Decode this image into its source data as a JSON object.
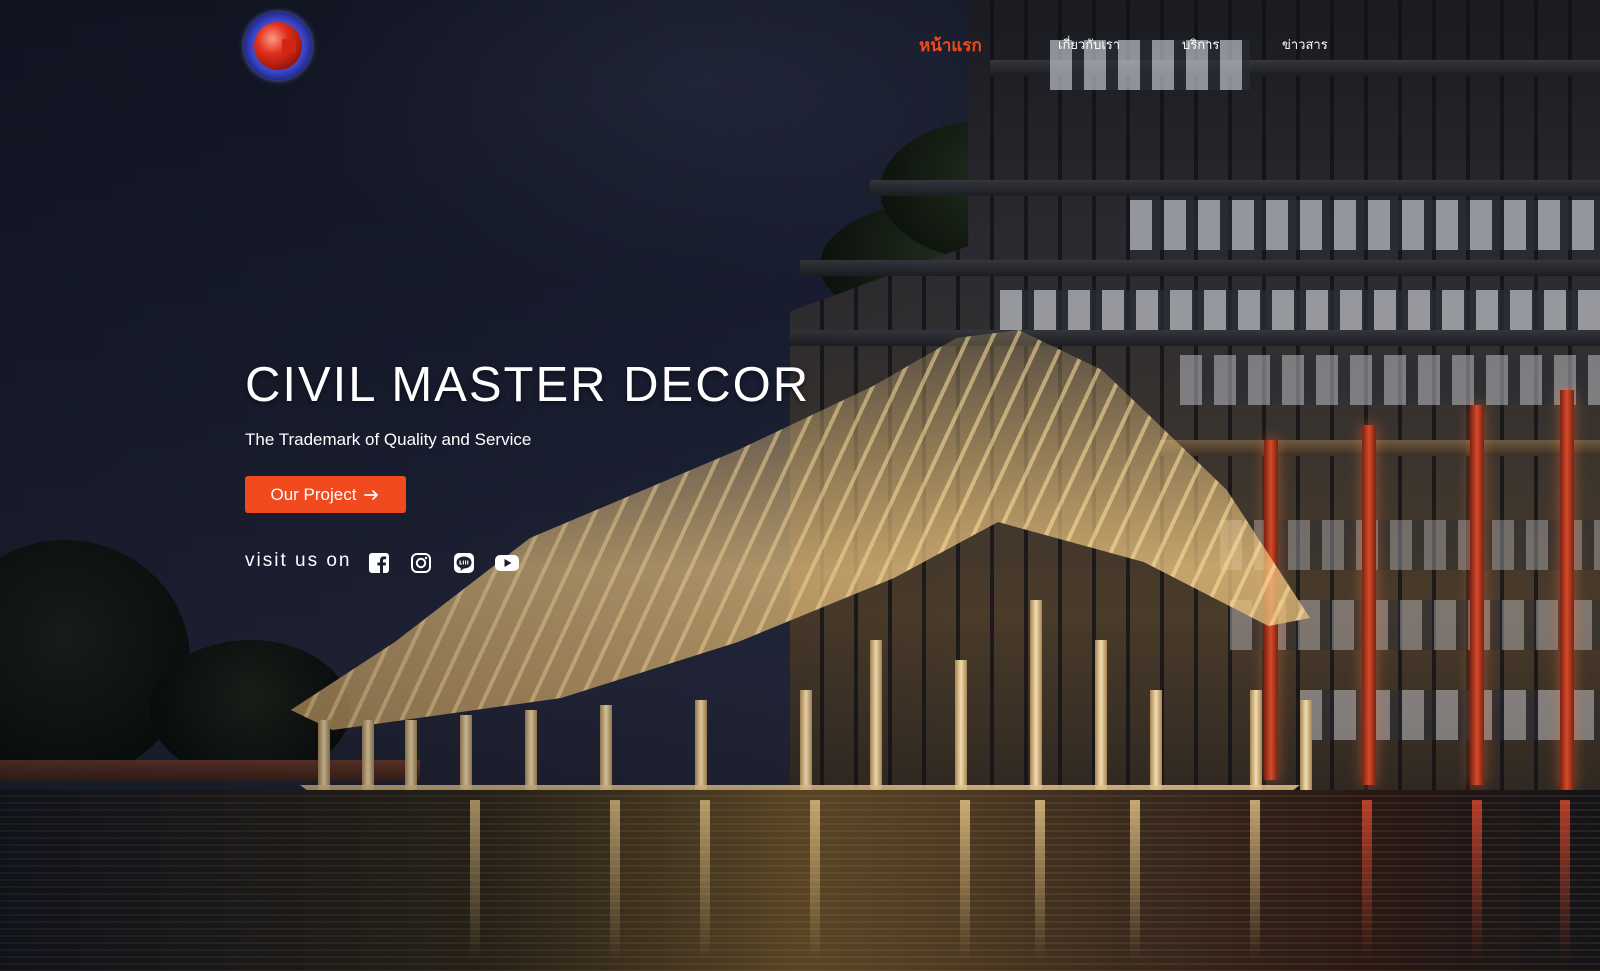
{
  "header": {
    "logo_alt": "Civil Master Decor logo",
    "nav": [
      {
        "label": "หน้าแรก",
        "active": true
      },
      {
        "label": "เกี่ยวกับเรา",
        "active": false
      },
      {
        "label": "บริการ",
        "active": false
      },
      {
        "label": "ข่าวสาร",
        "active": false
      }
    ]
  },
  "hero": {
    "title": "CIVIL MASTER DECOR",
    "subtitle": "The Trademark of Quality and Service",
    "cta_label": "Our Project",
    "cta_icon": "arrow-right-icon",
    "visit_label": "visit us on",
    "social": [
      {
        "name": "facebook-icon"
      },
      {
        "name": "instagram-icon"
      },
      {
        "name": "line-icon"
      },
      {
        "name": "youtube-icon"
      }
    ]
  },
  "colors": {
    "accent": "#f04a1e",
    "text": "#ffffff",
    "sky": "#141827"
  }
}
